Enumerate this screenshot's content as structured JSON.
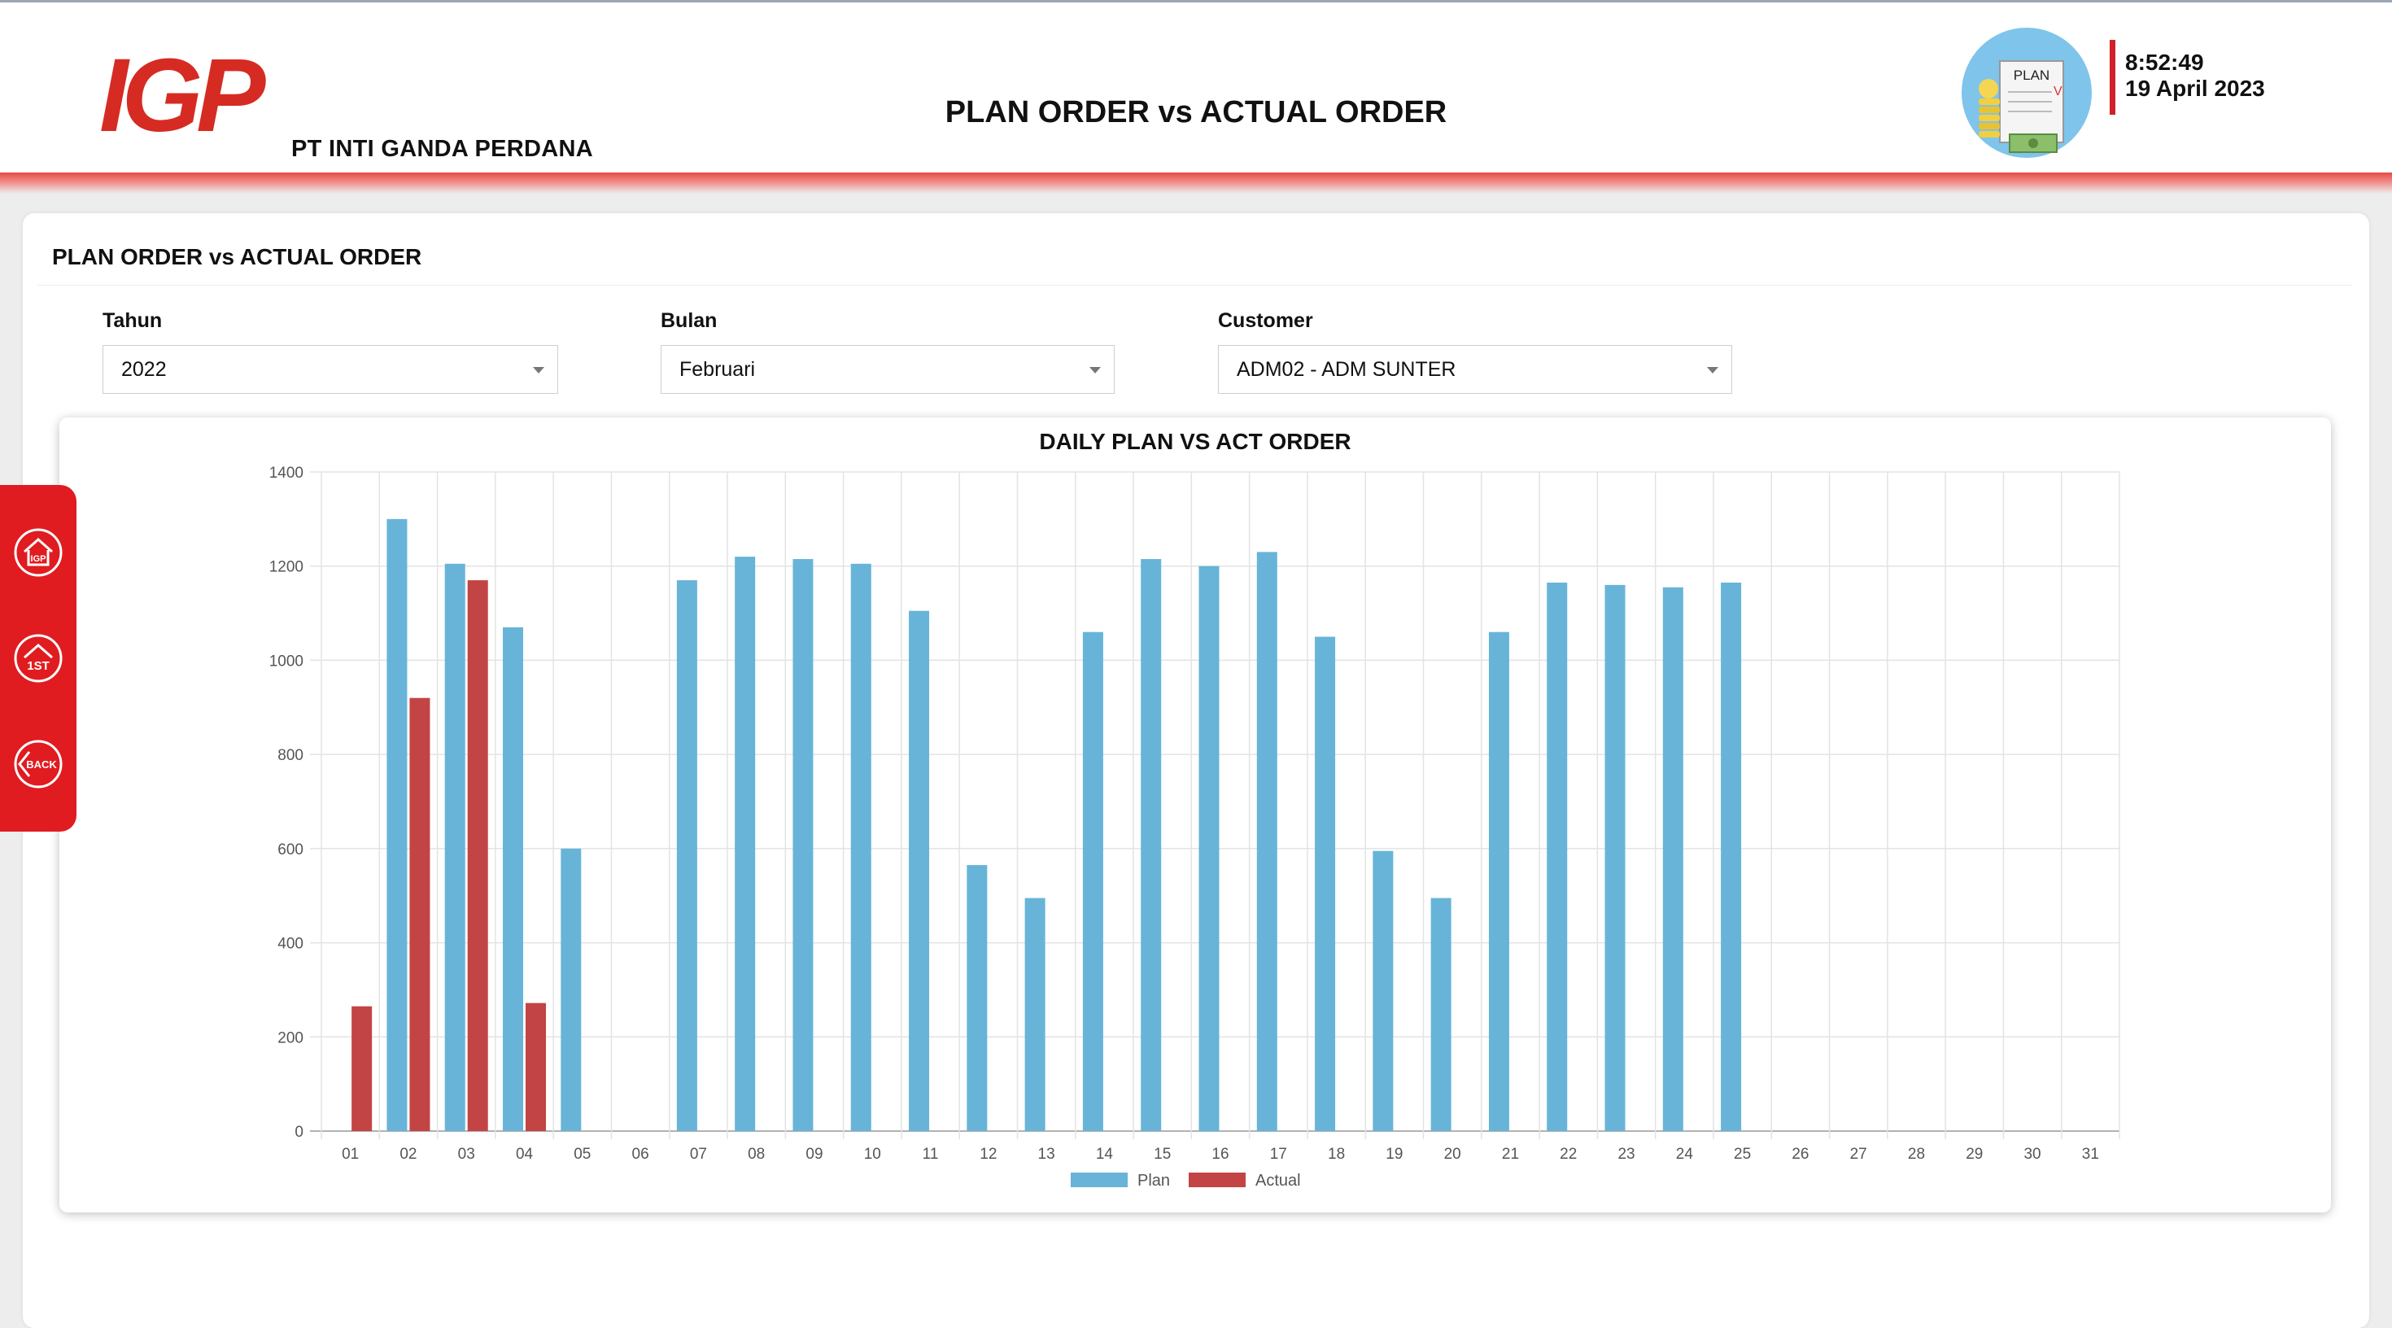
{
  "header": {
    "logo_text": "IGP",
    "company": "PT INTI GANDA PERDANA",
    "title": "PLAN ORDER vs ACTUAL ORDER",
    "badge_text": "PLAN",
    "time": "8:52:49",
    "date": "19 April 2023"
  },
  "panel": {
    "title": "PLAN ORDER vs ACTUAL ORDER"
  },
  "filters": {
    "year": {
      "label": "Tahun",
      "value": "2022"
    },
    "month": {
      "label": "Bulan",
      "value": "Februari"
    },
    "customer": {
      "label": "Customer",
      "value": "ADM02 - ADM SUNTER"
    }
  },
  "side_nav": {
    "items": [
      {
        "name": "igp-home-icon",
        "text": "IGP"
      },
      {
        "name": "1st-icon",
        "text": "1ST"
      },
      {
        "name": "back-icon",
        "text": "BACK"
      }
    ]
  },
  "colors": {
    "plan": "#67b4d8",
    "actual": "#c34444",
    "accent": "#e01c20"
  },
  "chart_data": {
    "type": "bar",
    "title": "DAILY PLAN VS ACT ORDER",
    "xlabel": "",
    "ylabel": "",
    "ylim": [
      0,
      1400
    ],
    "yticks": [
      0,
      200,
      400,
      600,
      800,
      1000,
      1200,
      1400
    ],
    "grid": true,
    "legend_position": "bottom",
    "categories": [
      "01",
      "02",
      "03",
      "04",
      "05",
      "06",
      "07",
      "08",
      "09",
      "10",
      "11",
      "12",
      "13",
      "14",
      "15",
      "16",
      "17",
      "18",
      "19",
      "20",
      "21",
      "22",
      "23",
      "24",
      "25",
      "26",
      "27",
      "28",
      "29",
      "30",
      "31"
    ],
    "series": [
      {
        "name": "Plan",
        "color": "#67b4d8",
        "values": [
          0,
          1300,
          1205,
          1070,
          600,
          0,
          1170,
          1220,
          1215,
          1205,
          1105,
          565,
          495,
          1060,
          1215,
          1200,
          1230,
          1050,
          595,
          495,
          1060,
          1165,
          1160,
          1155,
          1165,
          0,
          0,
          0,
          0,
          0,
          0
        ]
      },
      {
        "name": "Actual",
        "color": "#c34444",
        "values": [
          265,
          920,
          1170,
          272,
          0,
          0,
          0,
          0,
          0,
          0,
          0,
          0,
          0,
          0,
          0,
          0,
          0,
          0,
          0,
          0,
          0,
          0,
          0,
          0,
          0,
          0,
          0,
          0,
          0,
          0,
          0
        ]
      }
    ]
  }
}
